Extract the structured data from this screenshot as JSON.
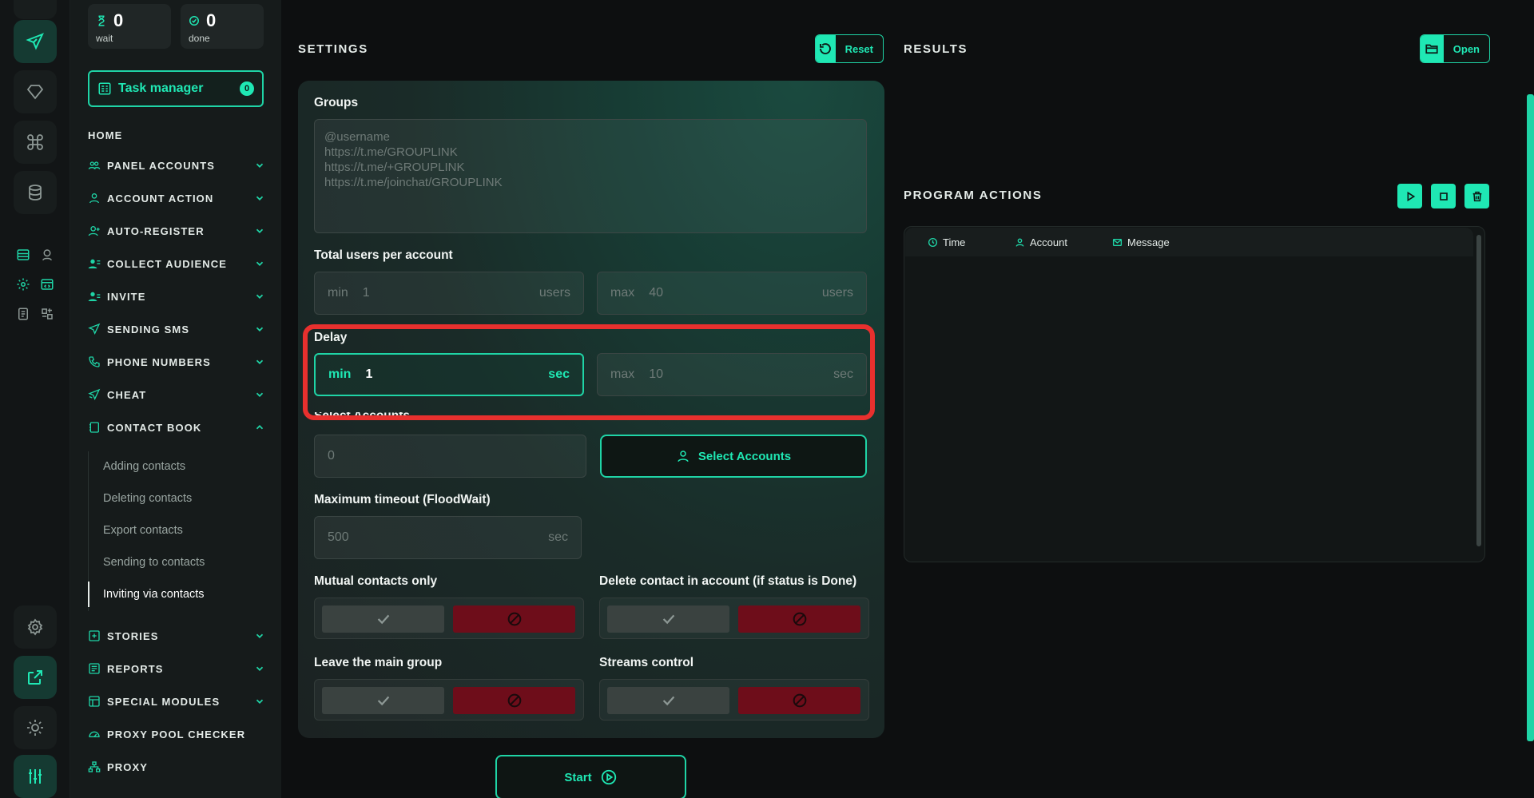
{
  "stats": {
    "wait": {
      "value": "0",
      "label": "wait"
    },
    "done": {
      "value": "0",
      "label": "done"
    }
  },
  "task_manager": {
    "label": "Task manager",
    "count": "0"
  },
  "nav": {
    "home": "HOME",
    "items": [
      "PANEL ACCOUNTS",
      "ACCOUNT ACTION",
      "AUTO-REGISTER",
      "COLLECT AUDIENCE",
      "INVITE",
      "SENDING SMS",
      "PHONE NUMBERS",
      "CHEAT",
      "CONTACT BOOK",
      "STORIES",
      "REPORTS",
      "SPECIAL MODULES",
      "PROXY POOL CHECKER",
      "PROXY"
    ],
    "sub_items": [
      "Adding contacts",
      "Deleting contacts",
      "Export contacts",
      "Sending to contacts",
      "Inviting via contacts"
    ]
  },
  "settings": {
    "title": "SETTINGS",
    "reset_label": "Reset",
    "groups_label": "Groups",
    "groups_placeholder": "@username\nhttps://t.me/GROUPLINK\nhttps://t.me/+GROUPLINK\nhttps://t.me/joinchat/GROUPLINK",
    "total_users_label": "Total users per account",
    "users_min": {
      "prefix": "min",
      "value": "1",
      "suffix": "users"
    },
    "users_max": {
      "prefix": "max",
      "value": "40",
      "suffix": "users"
    },
    "delay_label": "Delay",
    "delay_min": {
      "prefix": "min",
      "value": "1",
      "suffix": "sec"
    },
    "delay_max": {
      "prefix": "max",
      "value": "10",
      "suffix": "sec"
    },
    "select_accounts_label": "Select Accounts",
    "selected_count": "0",
    "select_accounts_button": "Select Accounts",
    "timeout_label": "Maximum timeout (FloodWait)",
    "timeout": {
      "value": "500",
      "suffix": "sec"
    },
    "mutual_label": "Mutual contacts only",
    "delete_contact_label": "Delete contact in account (if status is Done)",
    "leave_group_label": "Leave the main group",
    "streams_label": "Streams control",
    "start_label": "Start"
  },
  "results": {
    "title": "RESULTS",
    "open_label": "Open"
  },
  "program_actions": {
    "title": "PROGRAM ACTIONS",
    "columns": [
      "Time",
      "Account",
      "Message"
    ]
  },
  "colors": {
    "accent": "#1fe8b4",
    "danger": "#6e0d1a",
    "highlight": "#e8302e"
  }
}
